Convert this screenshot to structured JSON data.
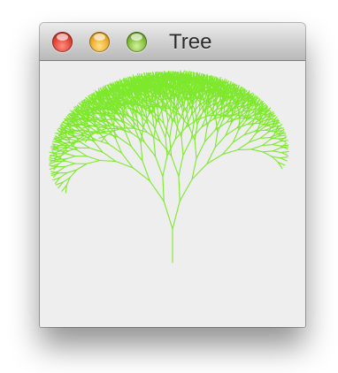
{
  "window": {
    "title": "Tree",
    "buttons": {
      "close": "close-button",
      "minimize": "minimize-button",
      "zoom": "zoom-button"
    }
  },
  "canvas": {
    "background": "#eeeeee",
    "line_color": "#7ee82c"
  }
}
